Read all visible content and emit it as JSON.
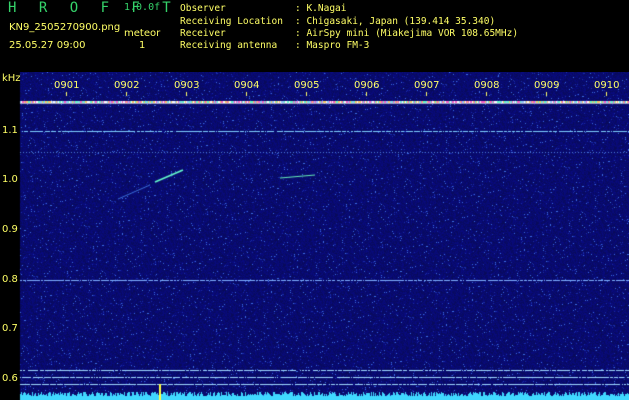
{
  "header": {
    "logo": "H R O F F T",
    "version": "1.0.0f",
    "filename": "KN9_2505270900.png",
    "meteor_label": "meteor",
    "datetime": "25.05.27 09:00",
    "meteor_count": "1"
  },
  "info": [
    {
      "key": "Observer",
      "value": ": K.Nagai"
    },
    {
      "key": "Receiving Location",
      "value": ": Chigasaki, Japan (139.414 35.340)"
    },
    {
      "key": "Receiver",
      "value": ": AirSpy mini (Miakejima VOR 108.65MHz)"
    },
    {
      "key": "Receiving antenna",
      "value": ": Maspro FM-3"
    }
  ],
  "spectrogram": {
    "unit_label": "kHz",
    "freq_ticks": [
      "1.1",
      "1.0",
      "0.9",
      "0.8",
      "0.7",
      "0.6"
    ],
    "time_ticks": [
      "0901",
      "0902",
      "0903",
      "0904",
      "0905",
      "0906",
      "0907",
      "0908",
      "0909",
      "0910"
    ],
    "colors": {
      "background": "#0d0d6e",
      "line": "#8fd8ff",
      "text": "#ffff66",
      "logo": "#35d36a"
    }
  }
}
